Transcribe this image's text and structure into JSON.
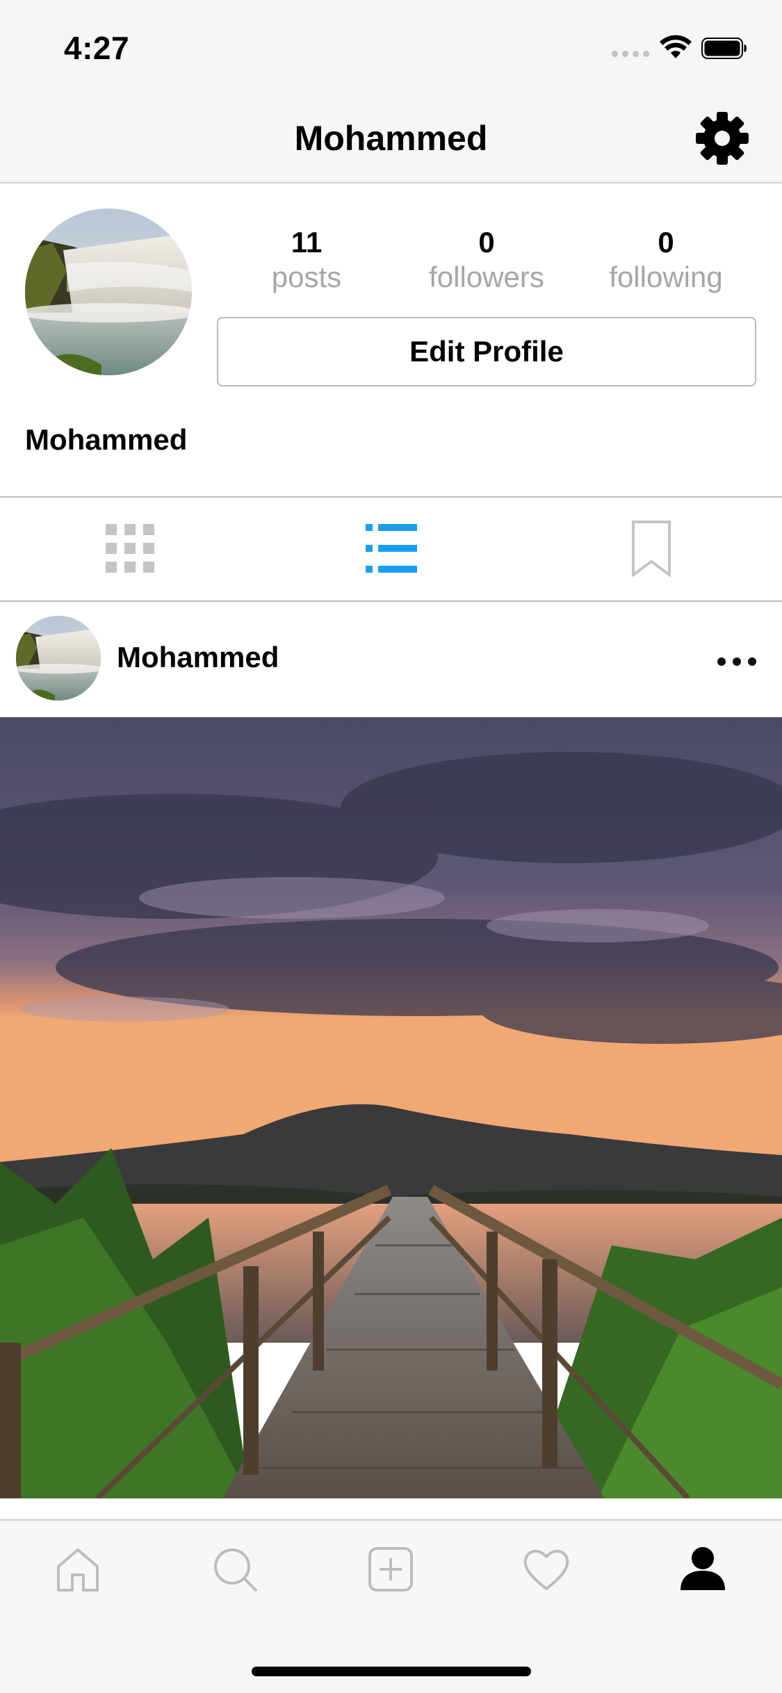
{
  "status_bar": {
    "time": "4:27"
  },
  "nav": {
    "title": "Mohammed",
    "settings_icon": "gear-icon"
  },
  "profile": {
    "stats": [
      {
        "value": "11",
        "label": "posts"
      },
      {
        "value": "0",
        "label": "followers"
      },
      {
        "value": "0",
        "label": "following"
      }
    ],
    "edit_button_label": "Edit Profile",
    "name": "Mohammed",
    "avatar": "waterfall-photo"
  },
  "view_tabs": [
    {
      "name": "grid-view",
      "icon": "grid-icon",
      "active": false
    },
    {
      "name": "list-view",
      "icon": "list-icon",
      "active": true
    },
    {
      "name": "saved",
      "icon": "bookmark-icon",
      "active": false
    }
  ],
  "post": {
    "username": "Mohammed",
    "menu_icon": "more-icon",
    "image": "sunset-boardwalk-photo"
  },
  "tab_bar": [
    {
      "name": "home",
      "icon": "home-icon"
    },
    {
      "name": "search",
      "icon": "search-icon"
    },
    {
      "name": "add",
      "icon": "add-icon"
    },
    {
      "name": "activity",
      "icon": "heart-icon"
    },
    {
      "name": "profile",
      "icon": "profile-icon",
      "active": true
    }
  ],
  "colors": {
    "accent": "#1a9ef0",
    "inactive_icon": "#c4c4c4",
    "secondary_text": "#a6a6a6",
    "bar_background": "#f6f6f6"
  }
}
